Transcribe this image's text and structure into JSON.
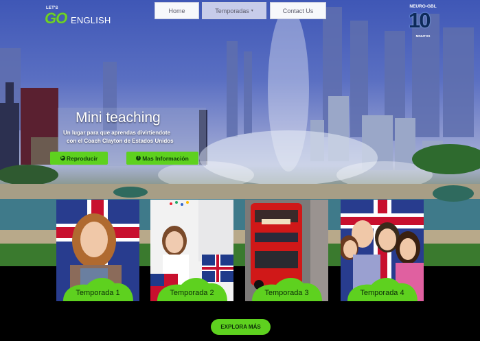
{
  "brand": {
    "lets": "LET'S",
    "go": "GO",
    "english": "ENGLISH"
  },
  "nav": {
    "home": "Home",
    "temporadas": "Temporadas",
    "caret": "▾",
    "contact": "Contact Us"
  },
  "partner": {
    "top": "NEURO-GBL",
    "number": "10",
    "bottom": "MINUTOS"
  },
  "hero": {
    "title": "Mini teaching",
    "subtitle_line1": "Un lugar para que aprendas divirtiendote",
    "subtitle_line2": "con el Coach Clayton de Estados Unidos",
    "play_label": "Reproducir",
    "info_label": "Mas Información",
    "play_icon": "play-circle-icon",
    "info_icon": "info-circle-icon"
  },
  "seasons": [
    {
      "label": "Temporada 1"
    },
    {
      "label": "Temporada 2"
    },
    {
      "label": "Temporada 3"
    },
    {
      "label": "Temporada 4"
    }
  ],
  "explore_label": "EXPLORA MÁS",
  "colors": {
    "accent": "#5ed11f",
    "sky": "#4a60bb",
    "background": "#000000"
  }
}
